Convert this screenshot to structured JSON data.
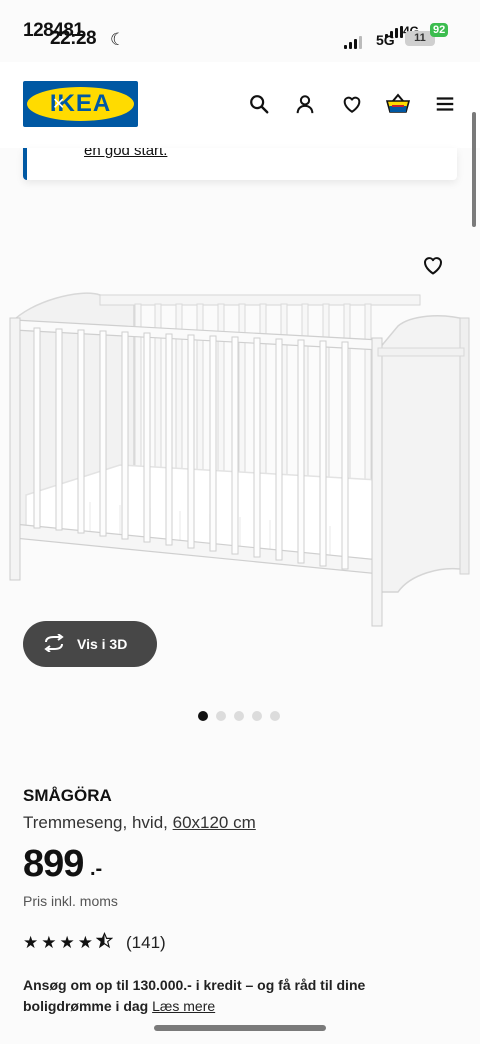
{
  "status": {
    "time_a": "128481",
    "time_b": "22:28",
    "network_a": "4G",
    "network_b": "5G",
    "battery_a": "92",
    "battery_b": "11"
  },
  "header": {
    "logo_text": "IKEA"
  },
  "banner": {
    "link": "en god start."
  },
  "product": {
    "view_3d_label": "Vis i 3D",
    "image_count": 5,
    "active_image": 0,
    "name": "SMÅGÖRA",
    "description": "Tremmeseng, hvid,",
    "size": "60x120 cm",
    "price": "899",
    "price_suffix": ".-",
    "vat_note": "Pris inkl. moms",
    "rating": 4.5,
    "rating_count": "(141)"
  },
  "credit": {
    "text": "Ansøg om op til 130.000.- i kredit – og få råd til dine boligdrømme i dag",
    "link": "Læs mere"
  },
  "icons": [
    "search-icon",
    "profile-icon",
    "heart-icon",
    "basket-icon",
    "menu-icon",
    "rotate-icon",
    "moon-icon"
  ]
}
